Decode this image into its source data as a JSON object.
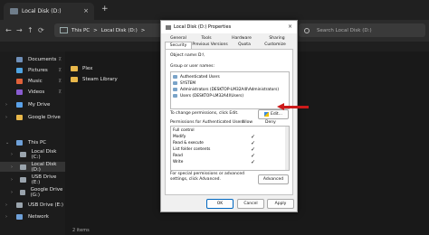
{
  "explorer": {
    "tab_title": "Local Disk (D:)",
    "tab_close": "×",
    "new_tab": "+",
    "nav": {
      "back": "←",
      "forward": "→",
      "up": "↑",
      "refresh": "⟳"
    },
    "address": [
      "This PC",
      ">",
      "Local Disk (D:)",
      ">"
    ],
    "search_placeholder": "Search Local Disk (D:)",
    "sidebar": [
      {
        "label": "Documents",
        "color": "#6f8fb8"
      },
      {
        "label": "Pictures",
        "color": "#4fa3e0"
      },
      {
        "label": "Music",
        "color": "#e0613a"
      },
      {
        "label": "Videos",
        "color": "#8a5cd1"
      },
      {
        "label": "My Drive",
        "color": "#5aa1e8"
      },
      {
        "label": "Google Drive",
        "color": "#e8b74a"
      },
      {
        "label": "This PC",
        "color": "#6ea0d8"
      },
      {
        "label": "Local Disk (C:)",
        "color": "#9aa4ad"
      },
      {
        "label": "Local Disk (D:)",
        "color": "#9aa4ad"
      },
      {
        "label": "USB Drive (E:)",
        "color": "#9aa4ad"
      },
      {
        "label": "Google Drive (G:)",
        "color": "#9aa4ad"
      },
      {
        "label": "USB Drive (E:)",
        "color": "#9aa4ad"
      },
      {
        "label": "Network",
        "color": "#6ea0d8"
      }
    ],
    "files": [
      "Plex",
      "Steam Library"
    ],
    "status": "2 items"
  },
  "dialog": {
    "title": "Local Disk (D:) Properties",
    "close": "×",
    "tabs_row1": [
      "General",
      "Tools",
      "Hardware",
      "Sharing"
    ],
    "tabs_row2": [
      "Security",
      "Previous Versions",
      "Quota",
      "Customize"
    ],
    "object_name_label": "Object name:",
    "object_name_value": "D:\\",
    "groups_label": "Group or user names:",
    "users": [
      "Authenticated Users",
      "SYSTEM",
      "Administrators (DESKTOP-LM32A4I\\Administrators)",
      "Users (DESKTOP-LM32A4I\\Users)"
    ],
    "change_hint": "To change permissions, click Edit.",
    "edit_label": "Edit...",
    "perms_label": "Permissions for Authenticated Users",
    "allow_label": "Allow",
    "deny_label": "Deny",
    "permissions": [
      {
        "name": "Full control",
        "allow": ""
      },
      {
        "name": "Modify",
        "allow": "✓"
      },
      {
        "name": "Read & execute",
        "allow": "✓"
      },
      {
        "name": "List folder contents",
        "allow": "✓"
      },
      {
        "name": "Read",
        "allow": "✓"
      },
      {
        "name": "Write",
        "allow": "✓"
      }
    ],
    "advanced_hint": "For special permissions or advanced settings, click Advanced.",
    "advanced_label": "Advanced",
    "ok": "OK",
    "cancel": "Cancel",
    "apply": "Apply"
  }
}
